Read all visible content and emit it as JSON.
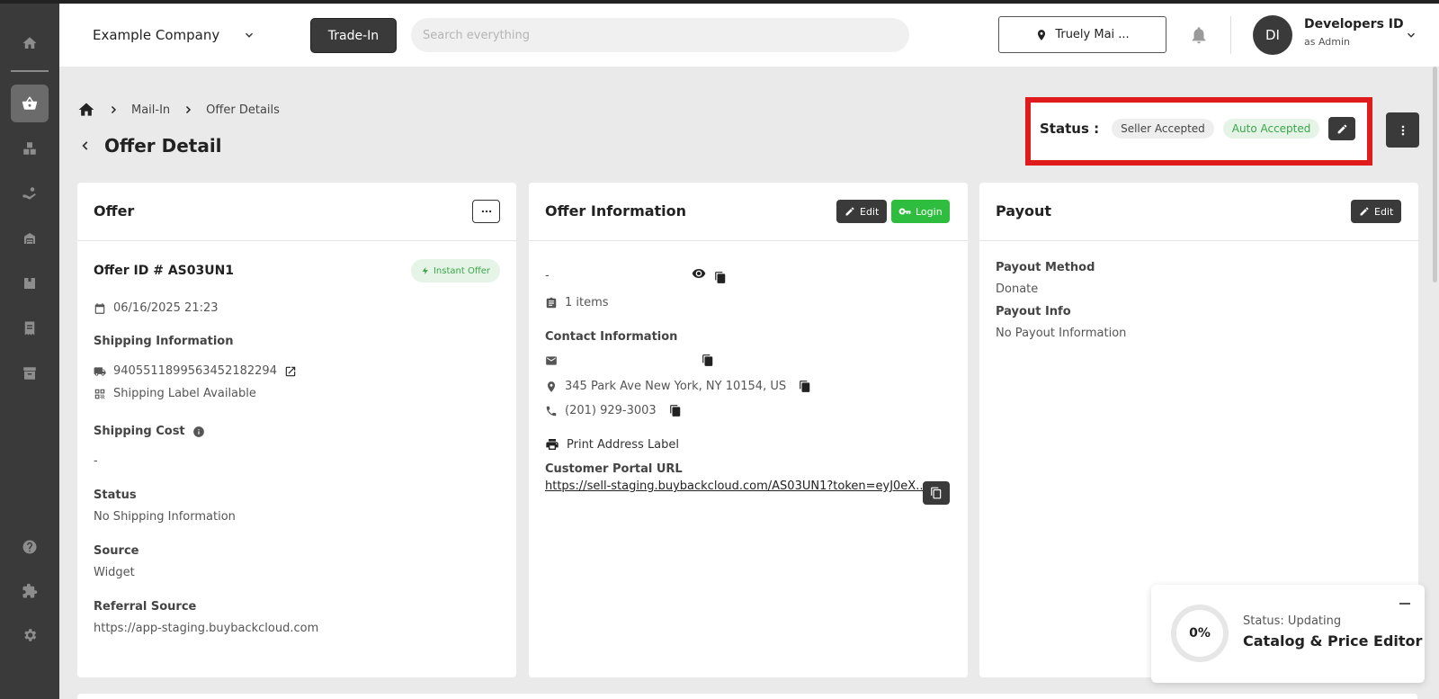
{
  "header": {
    "company": "Example Company",
    "trade_in": "Trade-In",
    "search_placeholder": "Search everything",
    "location": "Truely Mai ...",
    "user_initials": "DI",
    "user_name": "Developers ID",
    "user_role": "as Admin"
  },
  "sidebar": {
    "items": [
      "home-icon",
      "shopping-basket-icon",
      "boxes-icon",
      "hand-coin-icon",
      "warehouse-icon",
      "package-icon",
      "receipt-icon",
      "archive-icon",
      "help-icon",
      "puzzle-icon",
      "settings-icon"
    ],
    "active": "shopping-basket-icon"
  },
  "breadcrumb": [
    "Mail-In",
    "Offer Details"
  ],
  "page_title": "Offer Detail",
  "status": {
    "label": "Status :",
    "seller": "Seller Accepted",
    "auto": "Auto Accepted",
    "highlight_color": "#e01b1b"
  },
  "offer": {
    "title": "Offer",
    "offer_id": "Offer ID # AS03UN1",
    "badge": "Instant Offer",
    "date": "06/16/2025 21:23",
    "shipping_info_label": "Shipping Information",
    "tracking": "9405511899563452182294",
    "label_available": "Shipping Label Available",
    "shipping_cost_label": "Shipping Cost",
    "shipping_cost": "-",
    "status_label": "Status",
    "status_value": "No Shipping Information",
    "source_label": "Source",
    "source_value": "Widget",
    "referral_label": "Referral Source",
    "referral_value": "https://app-staging.buybackcloud.com"
  },
  "offer_info": {
    "title": "Offer Information",
    "edit": "Edit",
    "login": "Login",
    "dash": "-",
    "items": "1 items",
    "contact_label": "Contact Information",
    "address": "345 Park Ave New York, NY 10154, US",
    "phone": "(201) 929-3003",
    "print_label": "Print Address Label",
    "portal_label": "Customer Portal URL",
    "portal_url": "https://sell-staging.buybackcloud.com/AS03UN1?token=eyJ0eX..."
  },
  "payout": {
    "title": "Payout",
    "edit": "Edit",
    "method_label": "Payout Method",
    "method_value": "Donate",
    "info_label": "Payout Info",
    "info_value": "No Payout Information"
  },
  "toast": {
    "percent": "0%",
    "status": "Status: Updating",
    "title": "Catalog & Price Editor"
  }
}
